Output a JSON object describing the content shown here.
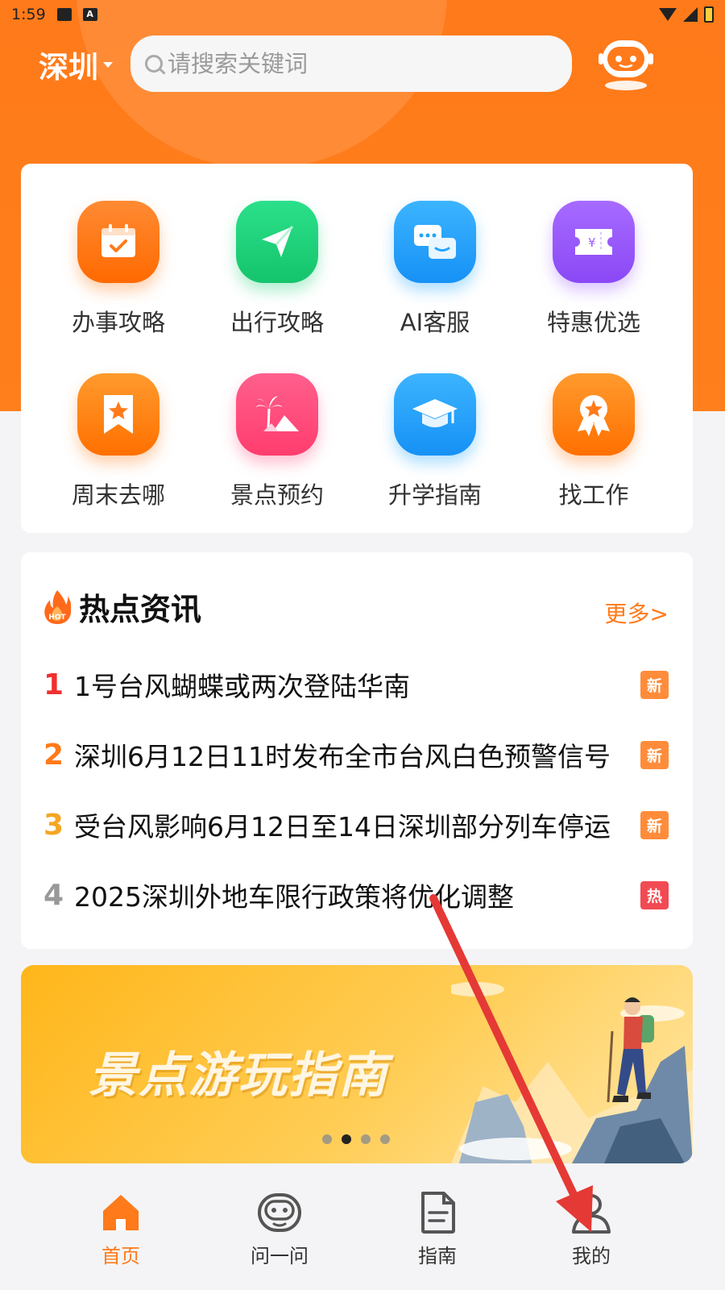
{
  "status_bar": {
    "time": "1:59",
    "mini_icon_letter": "A"
  },
  "header": {
    "city": "深圳",
    "search": {
      "value": "",
      "placeholder": "请搜索关键词"
    }
  },
  "services": [
    {
      "label": "办事攻略",
      "icon": "calendar-check-icon",
      "color": "#ff7a1a"
    },
    {
      "label": "出行攻略",
      "icon": "send-icon",
      "color": "#21d17b"
    },
    {
      "label": "AI客服",
      "icon": "chat-bubbles-icon",
      "color": "#1fa5ff"
    },
    {
      "label": "特惠优选",
      "icon": "coupon-icon",
      "color": "#9b5cff"
    },
    {
      "label": "周末去哪",
      "icon": "bookmark-star-icon",
      "color": "#ff7a1a"
    },
    {
      "label": "景点预约",
      "icon": "palm-mountain-icon",
      "color": "#ff4d7e"
    },
    {
      "label": "升学指南",
      "icon": "graduation-cap-icon",
      "color": "#1fa5ff"
    },
    {
      "label": "找工作",
      "icon": "medal-icon",
      "color": "#ff7a1a"
    }
  ],
  "hot_news": {
    "title": "热点资讯",
    "badge": "HOT",
    "more": "更多>",
    "items": [
      {
        "rank": "1",
        "text": "1号台风蝴蝶或两次登陆华南",
        "tag": "新",
        "rank_color": "#f0302e",
        "tag_color": "#ff8c3a"
      },
      {
        "rank": "2",
        "text": "深圳6月12日11时发布全市台风白色预警信号",
        "tag": "新",
        "rank_color": "#ff7a1a",
        "tag_color": "#ff8c3a"
      },
      {
        "rank": "3",
        "text": "受台风影响6月12日至14日深圳部分列车停运",
        "tag": "新",
        "rank_color": "#f5a623",
        "tag_color": "#ff8c3a"
      },
      {
        "rank": "4",
        "text": "2025深圳外地车限行政策将优化调整",
        "tag": "热",
        "rank_color": "#999999",
        "tag_color": "#f24a52"
      }
    ]
  },
  "banner": {
    "title": "景点游玩指南",
    "slide_count": 4,
    "active_slide": 2
  },
  "bottom_nav": [
    {
      "label": "首页",
      "icon": "home-icon",
      "active": true
    },
    {
      "label": "问一问",
      "icon": "robot-icon",
      "active": false
    },
    {
      "label": "指南",
      "icon": "document-icon",
      "active": false
    },
    {
      "label": "我的",
      "icon": "user-icon",
      "active": false
    }
  ],
  "colors": {
    "accent": "#ff7a1a",
    "annotation_arrow": "#e53935"
  }
}
